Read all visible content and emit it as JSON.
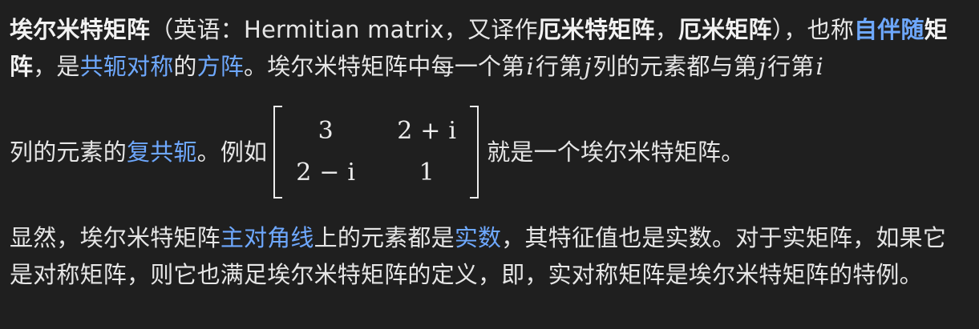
{
  "p1": {
    "t01": "埃尔米特矩阵",
    "t02": "（英语：Hermitian matrix，又译作",
    "t03": "厄米特矩阵",
    "t04": "，",
    "t05": "厄米矩阵",
    "t06": "），也称",
    "t07": "自伴随",
    "t08": "矩阵",
    "t09": "，是",
    "t10": "共轭对称",
    "t11": "的",
    "t12": "方阵",
    "t13": "。埃尔米特矩阵中每一个第",
    "t14": "i",
    "t15": "行第",
    "t16": "j",
    "t17": "列的元素都与第",
    "t18": "j",
    "t19": "行第",
    "t20": "i",
    "t21": "列的元素的",
    "t22": "复共轭",
    "t23": "。例如",
    "t24": "就是一个埃尔米特矩阵。"
  },
  "matrix": {
    "a11": "3",
    "a12": "2 + i",
    "a21": "2 − i",
    "a22": "1"
  },
  "p2": {
    "t01": "显然，埃尔米特矩阵",
    "t02": "主对角线",
    "t03": "上的元素都是",
    "t04": "实数",
    "t05": "，其特征值也是实数。对于实矩阵，如果它是对称矩阵，则它也满足埃尔米特矩阵的定义，即，实对称矩阵是埃尔米特矩阵的特例。"
  }
}
